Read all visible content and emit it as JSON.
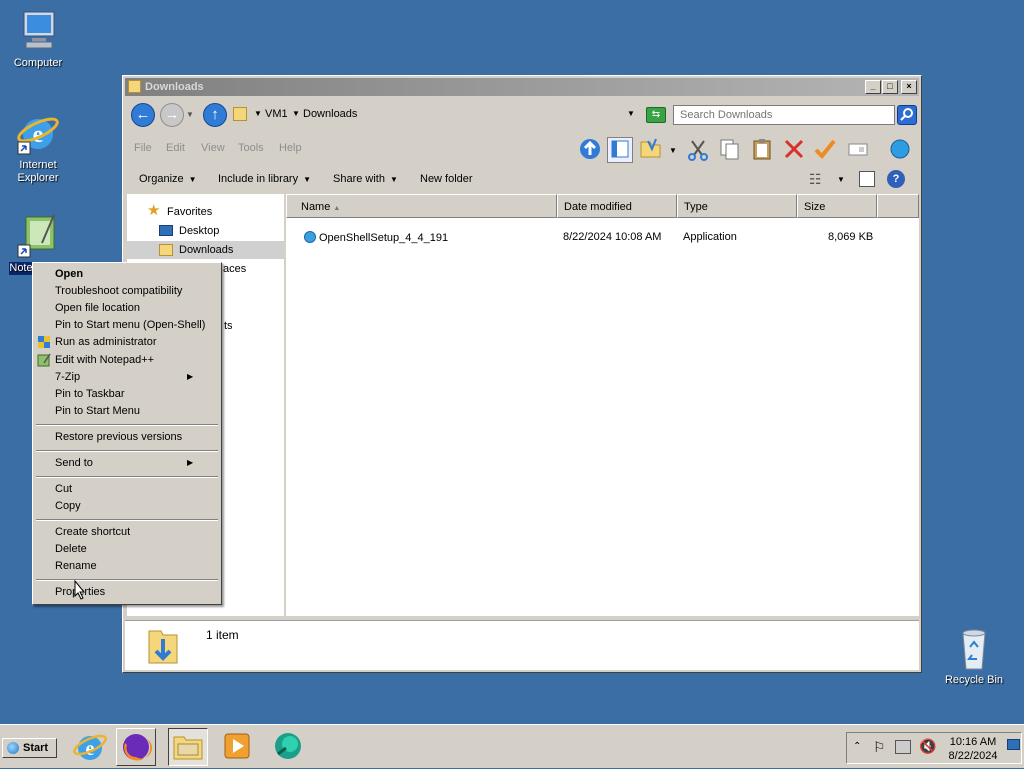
{
  "desktop": {
    "icons": [
      {
        "label": "Computer"
      },
      {
        "label": "Internet\nExplorer"
      },
      {
        "label": "Note"
      },
      {
        "label": "Recycle Bin"
      }
    ]
  },
  "window": {
    "title": "Downloads",
    "address": {
      "root": "VM1",
      "current": "Downloads",
      "sep": "▸"
    },
    "search_placeholder": "Search Downloads",
    "menu": [
      "File",
      "Edit",
      "View",
      "Tools",
      "Help"
    ],
    "commands": [
      "Organize",
      "Include in library",
      "Share with",
      "New folder"
    ],
    "nav": {
      "favorites": "Favorites",
      "desktop": "Desktop",
      "downloads": "Downloads",
      "recent_partial": "aces",
      "partial2": "ts"
    },
    "columns": [
      "Name",
      "Date modified",
      "Type",
      "Size"
    ],
    "files": [
      {
        "name": "OpenShellSetup_4_4_191",
        "date": "8/22/2024 10:08 AM",
        "type": "Application",
        "size": "8,069 KB"
      }
    ],
    "status": "1 item"
  },
  "context_menu": {
    "items": [
      "Open",
      "Troubleshoot compatibility",
      "Open file location",
      "Pin to Start menu (Open-Shell)",
      "Run as administrator",
      "Edit with Notepad++",
      "7-Zip",
      "Pin to Taskbar",
      "Pin to Start Menu",
      "Restore previous versions",
      "Send to",
      "Cut",
      "Copy",
      "Create shortcut",
      "Delete",
      "Rename",
      "Properties"
    ]
  },
  "taskbar": {
    "start": "Start",
    "time": "10:16 AM",
    "date": "8/22/2024"
  },
  "colors": {
    "desktop": "#3a6ea5",
    "face": "#d4d0c8",
    "accent": "#2b6dd4"
  }
}
